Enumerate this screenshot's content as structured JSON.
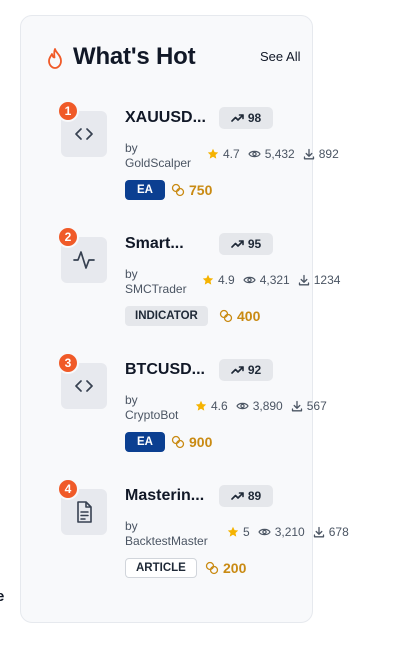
{
  "edge_text": "e",
  "widget": {
    "title": "What's Hot",
    "see_all": "See All",
    "by_prefix": "by",
    "items": [
      {
        "rank": "1",
        "icon": "code-icon",
        "name": "XAUUSD...",
        "trend": "98",
        "author": "GoldScalper",
        "rating": "4.7",
        "views": "5,432",
        "downloads": "892",
        "type": "EA",
        "type_style": "ea",
        "price": "750"
      },
      {
        "rank": "2",
        "icon": "activity-icon",
        "name": "Smart...",
        "trend": "95",
        "author": "SMCTrader",
        "rating": "4.9",
        "views": "4,321",
        "downloads": "1234",
        "type": "INDICATOR",
        "type_style": "indicator",
        "price": "400"
      },
      {
        "rank": "3",
        "icon": "code-icon",
        "name": "BTCUSD...",
        "trend": "92",
        "author": "CryptoBot",
        "rating": "4.6",
        "views": "3,890",
        "downloads": "567",
        "type": "EA",
        "type_style": "ea",
        "price": "900"
      },
      {
        "rank": "4",
        "icon": "document-icon",
        "name": "Masterin...",
        "trend": "89",
        "author": "BacktestMaster",
        "rating": "5",
        "views": "3,210",
        "downloads": "678",
        "type": "ARTICLE",
        "type_style": "article",
        "price": "200"
      }
    ]
  },
  "colors": {
    "accent_orange": "#f05a28",
    "ea_badge": "#0b3f91",
    "price_gold": "#c98a12",
    "star": "#f5b301"
  }
}
